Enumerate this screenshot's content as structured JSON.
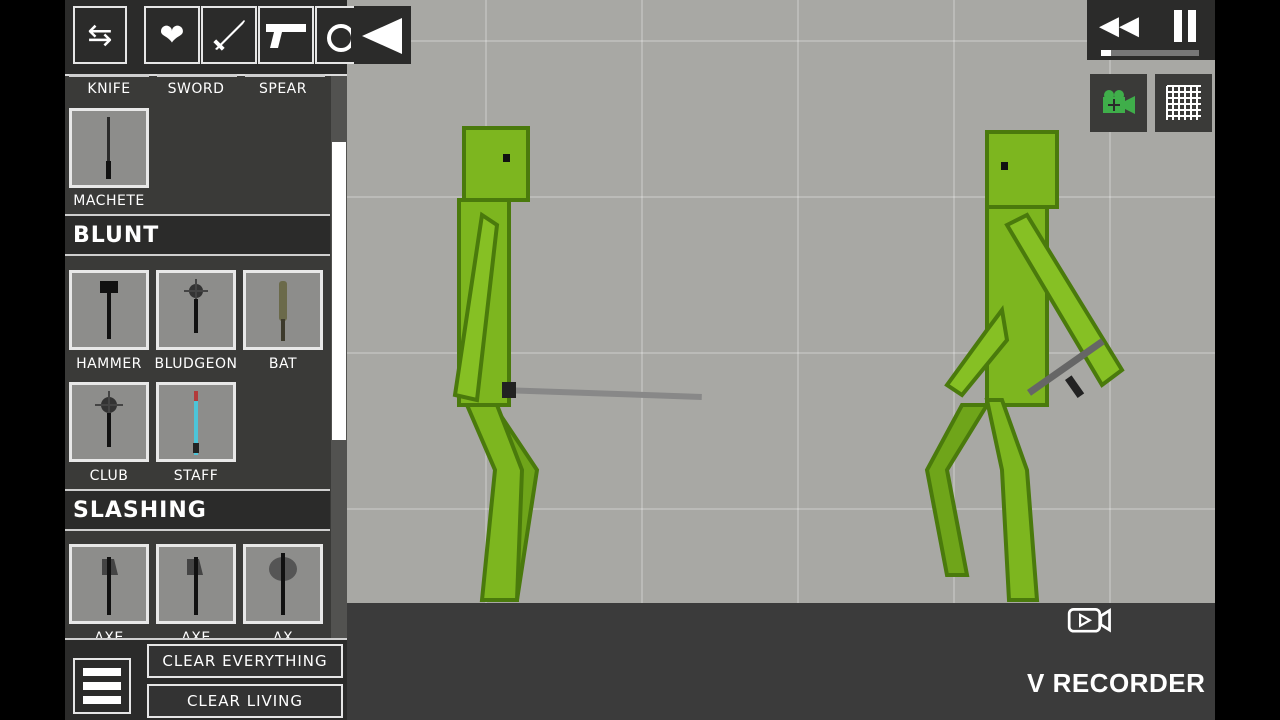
{
  "topbar": {
    "tabs": [
      {
        "icon": "swap-arrows-icon"
      },
      {
        "icon": "heart-icon"
      },
      {
        "icon": "sword-icon"
      },
      {
        "icon": "pistol-icon"
      },
      {
        "icon": "explosive-icon"
      }
    ],
    "collapse_icon": "collapse-triangle-icon"
  },
  "panel": {
    "top_labels": [
      "KNIFE",
      "SWORD",
      "SPEAR"
    ],
    "sharp_items": [
      {
        "label": "MACHETE"
      }
    ],
    "categories": {
      "blunt": "BLUNT",
      "slashing": "SLASHING"
    },
    "blunt_items": [
      {
        "label": "HAMMER"
      },
      {
        "label": "BLUDGEON"
      },
      {
        "label": "BAT"
      },
      {
        "label": "CLUB"
      },
      {
        "label": "STAFF"
      }
    ],
    "slashing_items": [
      {
        "label": "AXE"
      },
      {
        "label": "AXE"
      },
      {
        "label": "AX"
      }
    ],
    "clear_everything": "CLEAR EVERYTHING",
    "clear_living": "CLEAR LIVING"
  },
  "controls": {
    "rewind_icon": "rewind-icon",
    "pause_icon": "pause-icon",
    "camera_icon": "camera-move-icon",
    "grid_icon": "grid-icon",
    "timeline_progress": 0.1
  },
  "watermark": {
    "text": "V RECORDER"
  },
  "colors": {
    "melon_green": "#7db61f",
    "melon_outline": "#4a7a0c",
    "panel_dark": "#2b2b2a",
    "floor": "#3b3b3b"
  }
}
